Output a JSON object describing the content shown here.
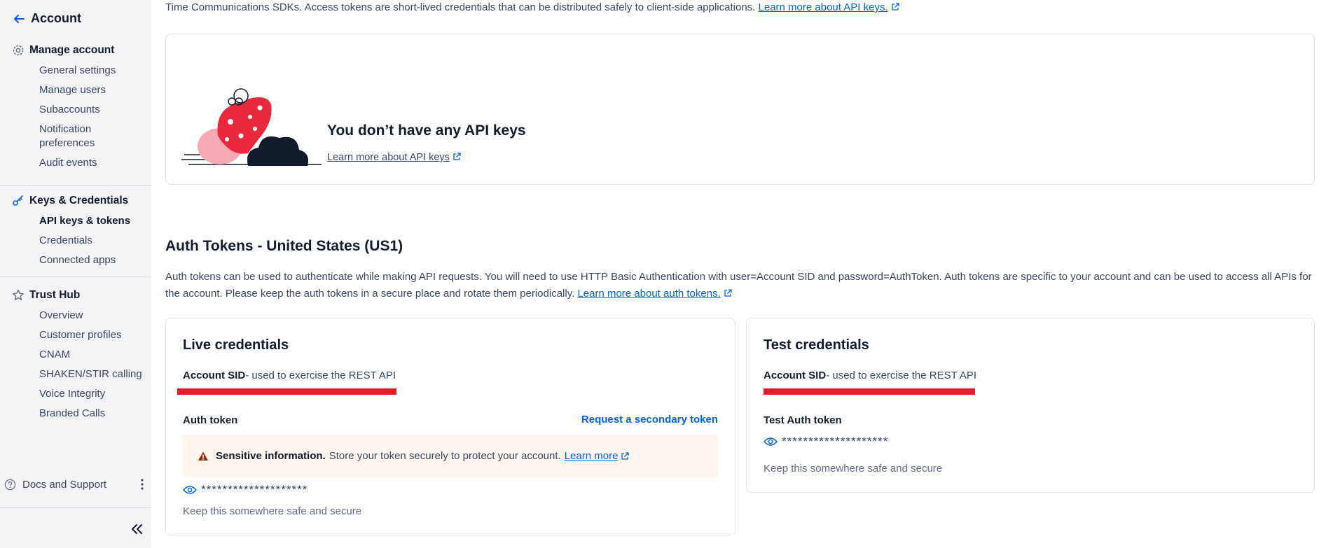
{
  "sidebar": {
    "back_label": "Account",
    "groups": [
      {
        "title": "Manage account",
        "icon": "gear-icon",
        "items": [
          "General settings",
          "Manage users",
          "Subaccounts",
          "Notification preferences",
          "Audit events"
        ]
      },
      {
        "title": "Keys & Credentials",
        "icon": "key-icon",
        "items": [
          "API keys & tokens",
          "Credentials",
          "Connected apps"
        ],
        "active_item": "API keys & tokens"
      },
      {
        "title": "Trust Hub",
        "icon": "star-icon",
        "items": [
          "Overview",
          "Customer profiles",
          "CNAM",
          "SHAKEN/STIR calling",
          "Voice Integrity",
          "Branded Calls"
        ]
      }
    ],
    "docs_label": "Docs and Support"
  },
  "main": {
    "intro_text": "Time Communications SDKs. Access tokens are short-lived credentials that can be distributed safely to client-side applications.",
    "intro_link": "Learn more about API keys.",
    "empty_state": {
      "title": "You don’t have any API keys",
      "link": "Learn more about API keys"
    },
    "auth_section": {
      "title": "Auth Tokens - United States (US1)",
      "description": "Auth tokens can be used to authenticate while making API requests. You will need to use HTTP Basic Authentication with user=Account SID and password=AuthToken. Auth tokens are specific to your account and can be used to access all APIs for the account. Please keep the auth tokens in a secure place and rotate them periodically.",
      "link": "Learn more about auth tokens."
    },
    "live": {
      "title": "Live credentials",
      "sid_label": "Account SID",
      "sid_desc": "- used to exercise the REST API",
      "auth_label": "Auth token",
      "request_button": "Request a secondary token",
      "warning_bold": "Sensitive information.",
      "warning_text": "Store your token securely to protect your account.",
      "warning_link": "Learn more",
      "token_mask": "********************",
      "hint": "Keep this somewhere safe and secure"
    },
    "test": {
      "title": "Test credentials",
      "sid_label": "Account SID",
      "sid_desc": "- used to exercise the REST API",
      "auth_label": "Test Auth token",
      "token_mask": "********************",
      "hint": "Keep this somewhere safe and secure"
    }
  },
  "colors": {
    "accent": "#0263e0",
    "redaction": "#e11d2d",
    "warning_bg": "#fef5ee",
    "sidebar_bg": "#f4f4f6"
  }
}
